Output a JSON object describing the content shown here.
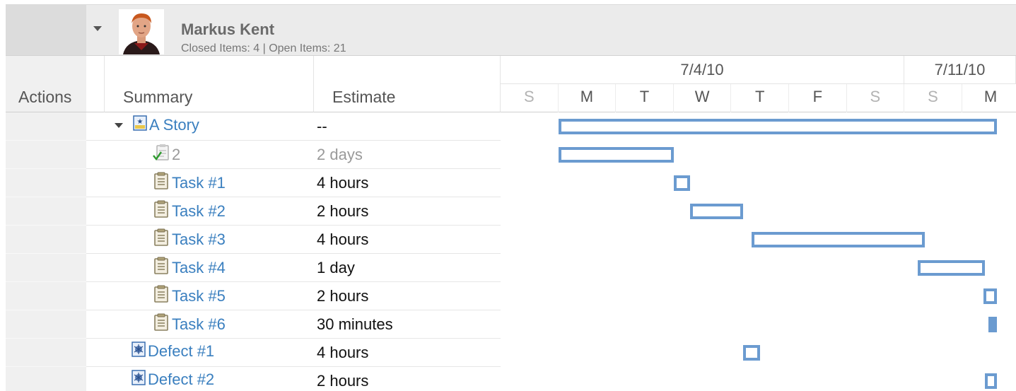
{
  "user": {
    "name": "Markus Kent",
    "stats": "Closed Items: 4 | Open Items: 21"
  },
  "columns": {
    "actions": "Actions",
    "summary": "Summary",
    "estimate": "Estimate"
  },
  "timeline": {
    "weeks": [
      "7/4/10",
      "7/11/10"
    ],
    "days": [
      "S",
      "M",
      "T",
      "W",
      "T",
      "F",
      "S",
      "S",
      "M"
    ]
  },
  "colors": {
    "bar": "#6b9bd0",
    "link": "#3a7fbf"
  },
  "rows": [
    {
      "type": "story",
      "icon": "story-icon",
      "summary": "A Story",
      "estimate": "--",
      "start": 1.0,
      "end": 8.6
    },
    {
      "type": "sub",
      "icon": "completed-task-icon",
      "summary": "2",
      "estimate": "2 days",
      "start": 1.0,
      "end": 3.0
    },
    {
      "type": "task",
      "icon": "task-icon",
      "summary": "Task #1",
      "estimate": "4 hours",
      "start": 3.0,
      "end": 3.28
    },
    {
      "type": "task",
      "icon": "task-icon",
      "summary": "Task #2",
      "estimate": "2 hours",
      "start": 3.28,
      "end": 4.2
    },
    {
      "type": "task",
      "icon": "task-icon",
      "summary": "Task #3",
      "estimate": "4 hours",
      "start": 4.35,
      "end": 7.35
    },
    {
      "type": "task",
      "icon": "task-icon",
      "summary": "Task #4",
      "estimate": "1 day",
      "start": 7.23,
      "end": 8.4
    },
    {
      "type": "task",
      "icon": "task-icon",
      "summary": "Task #5",
      "estimate": "2 hours",
      "start": 8.37,
      "end": 8.6
    },
    {
      "type": "task",
      "icon": "task-icon",
      "summary": "Task #6",
      "estimate": "30 minutes",
      "start": 8.45,
      "end": 8.6
    },
    {
      "type": "defect",
      "icon": "defect-icon",
      "summary": "Defect #1",
      "estimate": "4 hours",
      "start": 4.2,
      "end": 4.5
    },
    {
      "type": "defect",
      "icon": "defect-icon",
      "summary": "Defect #2",
      "estimate": "2 hours",
      "start": 8.4,
      "end": 8.6
    }
  ]
}
